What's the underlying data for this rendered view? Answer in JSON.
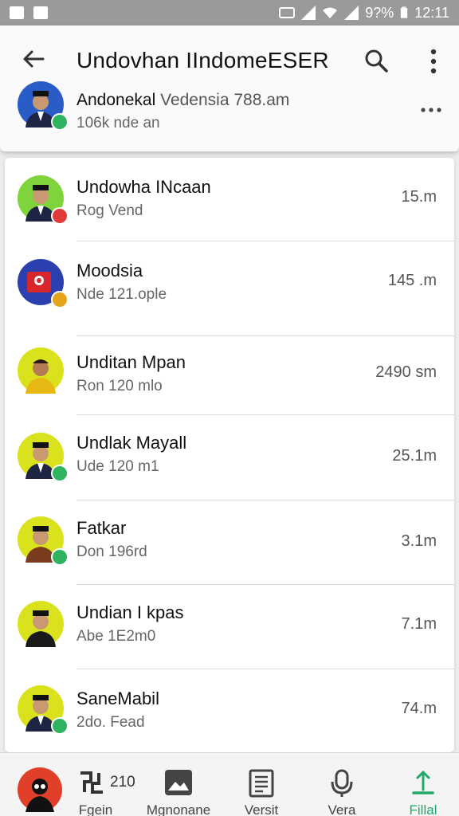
{
  "status_bar": {
    "battery": "9?%",
    "time": "12:11"
  },
  "app_bar": {
    "title": "Undovhan IIndomeESER"
  },
  "owner": {
    "name": "Andonekal",
    "name_extra": "Vedensia 788.am",
    "subtitle": "106k nde an",
    "avatar_color": "#2a5cc8",
    "badge_color": "#2fb35f"
  },
  "contacts": [
    {
      "name": "Undowha INcaan",
      "subtitle": "Rog Vend",
      "time": "15.m",
      "avatar_bg": "#7ed43a",
      "badge_color": "#e23b3b"
    },
    {
      "name": "Moodsia",
      "subtitle": "Nde 121.ople",
      "time": "145 .m",
      "avatar_bg": "#2b3fae",
      "badge_color": "#e5a51a"
    },
    {
      "name": "Unditan Mpan",
      "subtitle": "Ron 120 mlo",
      "time": "2490 sm",
      "avatar_bg": "#d9e21c",
      "badge_color": ""
    },
    {
      "name": "Undlak Mayall",
      "subtitle": "Ude 120 m1",
      "time": "25.1m",
      "avatar_bg": "#d9e21c",
      "badge_color": "#2fb35f"
    },
    {
      "name": "Fatkar",
      "subtitle": "Don 196rd",
      "time": "3.1m",
      "avatar_bg": "#d9e21c",
      "badge_color": "#2fb35f"
    },
    {
      "name": "Undian I kpas",
      "subtitle": "Abe 1E2m0",
      "time": "7.1m",
      "avatar_bg": "#d9e21c",
      "badge_color": ""
    },
    {
      "name": "SaneMabil",
      "subtitle": "2do. Fead",
      "time": "74.m",
      "avatar_bg": "#d9e21c",
      "badge_color": "#2fb35f"
    }
  ],
  "bottom_nav": [
    {
      "label": "Fgein",
      "icon": "profile-icon",
      "extra": "210"
    },
    {
      "label": "Mgnonane",
      "icon": "image-icon"
    },
    {
      "label": "Versit",
      "icon": "document-icon"
    },
    {
      "label": "Vera",
      "icon": "microphone-icon"
    },
    {
      "label": "Fillal",
      "icon": "upload-icon",
      "active": true
    }
  ],
  "colors": {
    "accent": "#1faa6a",
    "appbar": "#fafafa",
    "status_bar": "#9a9a9a"
  }
}
